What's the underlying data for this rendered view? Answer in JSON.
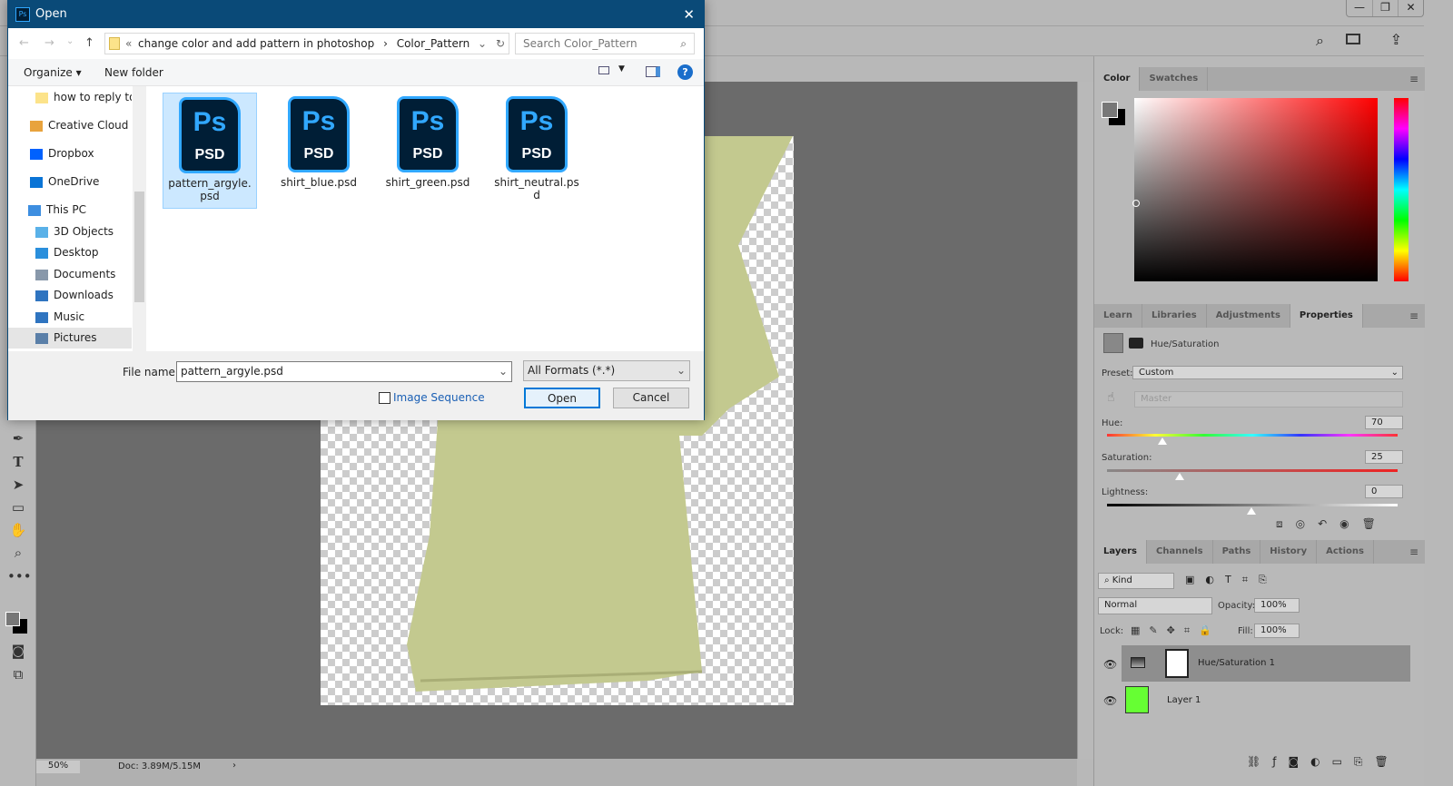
{
  "app": {
    "window_controls": [
      "—",
      "❐",
      "✕"
    ]
  },
  "status": {
    "zoom": "50%",
    "doc": "Doc: 3.89M/5.15M",
    "arrow": "›"
  },
  "color_panel": {
    "tabs": [
      "Color",
      "Swatches"
    ],
    "active": "Color"
  },
  "properties_panel": {
    "tabs": [
      "Learn",
      "Libraries",
      "Adjustments",
      "Properties"
    ],
    "active": "Properties",
    "title": "Hue/Saturation",
    "preset_label": "Preset:",
    "preset_value": "Custom",
    "channel": "Master",
    "hue_label": "Hue:",
    "hue": "70",
    "saturation_label": "Saturation:",
    "saturation": "25",
    "lightness_label": "Lightness:",
    "lightness": "0"
  },
  "layers_panel": {
    "tabs": [
      "Layers",
      "Channels",
      "Paths",
      "History",
      "Actions"
    ],
    "active": "Layers",
    "filter": "Kind",
    "blend_mode": "Normal",
    "opacity_label": "Opacity:",
    "opacity": "100%",
    "lock_label": "Lock:",
    "fill_label": "Fill:",
    "fill": "100%",
    "layers": [
      {
        "name": "Hue/Saturation 1",
        "selected": true
      },
      {
        "name": "Layer 1",
        "selected": false
      }
    ]
  },
  "dialog": {
    "title": "Open",
    "breadcrumb": [
      "«",
      "change color and add pattern in photoshop",
      "›",
      "Color_Pattern"
    ],
    "search_placeholder": "Search Color_Pattern",
    "organize": "Organize ▾",
    "new_folder": "New folder",
    "nav_items": [
      {
        "label": "how to reply to a",
        "icon": "folder"
      },
      {
        "label": "Creative Cloud Fil",
        "icon": "creative-cloud"
      },
      {
        "label": "Dropbox",
        "icon": "dropbox"
      },
      {
        "label": "OneDrive",
        "icon": "onedrive"
      },
      {
        "label": "This PC",
        "icon": "pc"
      },
      {
        "label": "3D Objects",
        "icon": "3d"
      },
      {
        "label": "Desktop",
        "icon": "desktop"
      },
      {
        "label": "Documents",
        "icon": "documents"
      },
      {
        "label": "Downloads",
        "icon": "downloads"
      },
      {
        "label": "Music",
        "icon": "music"
      },
      {
        "label": "Pictures",
        "icon": "pictures"
      }
    ],
    "files": [
      {
        "name": "pattern_argyle.psd",
        "selected": true
      },
      {
        "name": "shirt_blue.psd"
      },
      {
        "name": "shirt_green.psd"
      },
      {
        "name": "shirt_neutral.psd"
      }
    ],
    "file_icon": {
      "logo": "Ps",
      "ext": "PSD"
    },
    "file_name_label": "File name:",
    "file_name": "pattern_argyle.psd",
    "file_type": "All Formats (*.*)",
    "image_sequence": "Image Sequence",
    "open": "Open",
    "cancel": "Cancel"
  },
  "colors": {
    "ps_blue": "#31a8ff",
    "title_bar": "#0a4a78",
    "shirt": "#c3c98f"
  }
}
